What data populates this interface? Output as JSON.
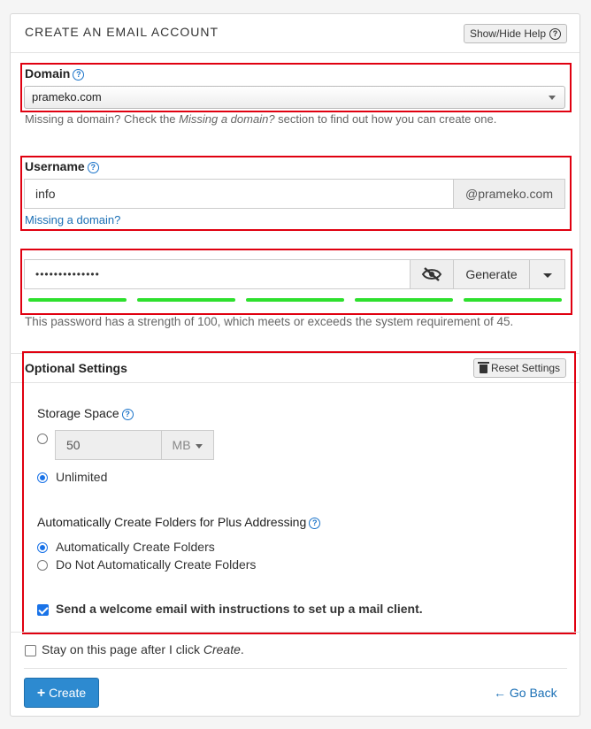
{
  "header": {
    "title": "CREATE AN EMAIL ACCOUNT",
    "help_toggle_label": "Show/Hide Help",
    "help_toggle_icon": "?"
  },
  "domain": {
    "label": "Domain",
    "help_icon": "?",
    "selected": "prameko.com",
    "hint_prefix": "Missing a domain? Check the ",
    "hint_emphasis": "Missing a domain?",
    "hint_suffix": " section to find out how you can create one."
  },
  "username": {
    "label": "Username",
    "help_icon": "?",
    "value": "info",
    "suffix": "@prameko.com",
    "missing_domain_link": "Missing a domain?"
  },
  "password": {
    "masked_value": "••••••••••••••",
    "generate_label": "Generate",
    "strength_segments_filled": 5,
    "strength_color": "#2de02d",
    "strength_text": "This password has a strength of 100, which meets or exceeds the system requirement of 45."
  },
  "optional": {
    "title": "Optional Settings",
    "reset_label": "Reset Settings",
    "storage": {
      "label": "Storage Space",
      "help_icon": "?",
      "value": "50",
      "unit": "MB",
      "unlimited_label": "Unlimited",
      "selected": "unlimited"
    },
    "plus_addressing": {
      "label": "Automatically Create Folders for Plus Addressing",
      "help_icon": "?",
      "option_auto": "Automatically Create Folders",
      "option_none": "Do Not Automatically Create Folders",
      "selected": "auto"
    },
    "welcome_email": {
      "label": "Send a welcome email with instructions to set up a mail client.",
      "checked": true
    }
  },
  "footer": {
    "stay_label_prefix": "Stay on this page after I click ",
    "stay_label_emphasis": "Create",
    "stay_label_suffix": ".",
    "stay_checked": false,
    "create_label": "Create",
    "create_icon": "+",
    "go_back_label": "Go Back",
    "go_back_icon": "←"
  },
  "colors": {
    "accent": "#1a73e8",
    "primary_button": "#2d8ad0",
    "link": "#1a6fb5",
    "highlight_border": "#e00010"
  }
}
